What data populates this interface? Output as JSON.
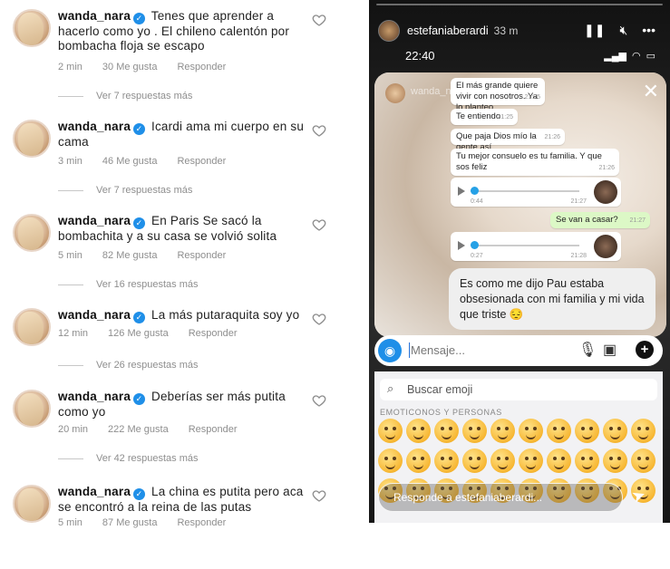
{
  "comments": [
    {
      "user": "wanda_nara",
      "text": "Tenes que aprender a hacerlo como yo . El chileno calentón por bombacha floja se escapo",
      "time": "2 min",
      "likes": "30 Me gusta",
      "reply": "Responder",
      "more": "Ver 7 respuestas más"
    },
    {
      "user": "wanda_nara",
      "text": "Icardi ama mi cuerpo en su cama",
      "time": "3 min",
      "likes": "46 Me gusta",
      "reply": "Responder",
      "more": "Ver 7 respuestas más"
    },
    {
      "user": "wanda_nara",
      "text": "En Paris Se sacó la bombachita y a su casa se volvió solita",
      "time": "5 min",
      "likes": "82 Me gusta",
      "reply": "Responder",
      "more": "Ver 16 respuestas más"
    },
    {
      "user": "wanda_nara",
      "text": "La más putaraquita soy yo",
      "time": "12 min",
      "likes": "126 Me gusta",
      "reply": "Responder",
      "more": "Ver 26 respuestas más"
    },
    {
      "user": "wanda_nara",
      "text": "Deberías ser más putita como yo",
      "time": "20 min",
      "likes": "222 Me gusta",
      "reply": "Responder",
      "more": "Ver 42 respuestas más"
    },
    {
      "user": "wanda_nara",
      "text": "La china es putita pero aca se encontró a la reina de las putas",
      "time": "5 min",
      "likes": "87 Me gusta",
      "reply": "Responder",
      "more": ""
    }
  ],
  "story": {
    "username": "estefaniaberardi",
    "time": "33 m",
    "clock": "22:40",
    "chat_name": "wanda_n",
    "messages": [
      {
        "text": "El más grande quiere vivir con nosotros. Ya lo planteo",
        "time": "21:25"
      },
      {
        "text": "Te entiendo",
        "time": "21:25"
      },
      {
        "text": "Que paja Dios mío la gente así",
        "time": "21:26"
      },
      {
        "text": "Tu mejor consuelo es tu familia. Y que sos feliz",
        "time": "21:26"
      },
      {
        "duration": "0:44",
        "time": "21:27"
      },
      {
        "text": "Se van a casar?",
        "time": "21:27"
      },
      {
        "duration": "0:27",
        "time": "21:28"
      }
    ],
    "reply_text": "Es como me dijo Pau estaba obsesionada con mi familia y mi vida que triste 😔",
    "message_placeholder": "Mensaje...",
    "emoji_search": "Buscar emoji",
    "emoji_category": "EMOTICONOS Y PERSONAS",
    "reply_placeholder": "Responde a estefaniaberardi..."
  }
}
